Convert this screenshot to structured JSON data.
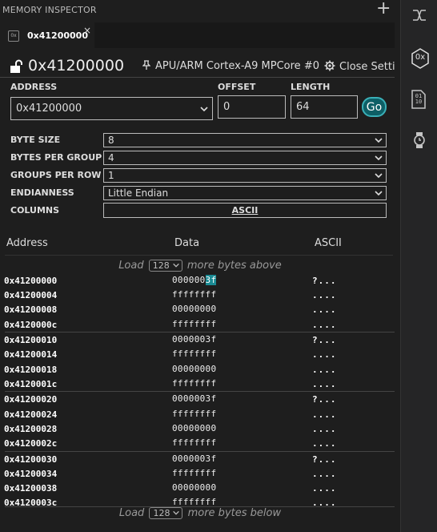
{
  "panel": {
    "title": "MEMORY INSPECTOR",
    "add_icon": "plus-icon"
  },
  "tab": {
    "label": "0x41200000",
    "close": "×"
  },
  "title_row": {
    "address": "0x41200000",
    "core_label": "APU/ARM Cortex-A9 MPCore #0",
    "close_settings_label": "Close Settings"
  },
  "form": {
    "address_label": "ADDRESS",
    "address_value": "0x41200000",
    "offset_label": "OFFSET",
    "offset_value": "0",
    "length_label": "LENGTH",
    "length_value": "64",
    "go_label": "Go"
  },
  "options": {
    "byte_size_label": "BYTE SIZE",
    "byte_size_value": "8",
    "bytes_per_group_label": "BYTES PER GROUP",
    "bytes_per_group_value": "4",
    "groups_per_row_label": "GROUPS PER ROW",
    "groups_per_row_value": "1",
    "endianness_label": "ENDIANNESS",
    "endianness_value": "Little Endian",
    "columns_label": "COLUMNS",
    "columns_button": "ASCII"
  },
  "table": {
    "headers": {
      "address": "Address",
      "data": "Data",
      "ascii": "ASCII"
    },
    "load_above": {
      "prefix": "Load",
      "count": "128",
      "suffix": "more bytes above"
    },
    "load_below": {
      "prefix": "Load",
      "count": "128",
      "suffix": "more bytes below"
    },
    "first_row": {
      "address": "0x41200000",
      "data_plain": "000000",
      "data_highlight": "3f",
      "ascii": "?..."
    },
    "rows": [
      {
        "address": "0x41200004",
        "data": "ffffffff",
        "ascii": "...."
      },
      {
        "address": "0x41200008",
        "data": "00000000",
        "ascii": "...."
      },
      {
        "address": "0x4120000c",
        "data": "ffffffff",
        "ascii": "...."
      },
      {
        "address": "0x41200010",
        "data": "0000003f",
        "ascii": "?..."
      },
      {
        "address": "0x41200014",
        "data": "ffffffff",
        "ascii": "...."
      },
      {
        "address": "0x41200018",
        "data": "00000000",
        "ascii": "...."
      },
      {
        "address": "0x4120001c",
        "data": "ffffffff",
        "ascii": "...."
      },
      {
        "address": "0x41200020",
        "data": "0000003f",
        "ascii": "?..."
      },
      {
        "address": "0x41200024",
        "data": "ffffffff",
        "ascii": "...."
      },
      {
        "address": "0x41200028",
        "data": "00000000",
        "ascii": "...."
      },
      {
        "address": "0x4120002c",
        "data": "ffffffff",
        "ascii": "...."
      },
      {
        "address": "0x41200030",
        "data": "0000003f",
        "ascii": "?..."
      },
      {
        "address": "0x41200034",
        "data": "ffffffff",
        "ascii": "...."
      },
      {
        "address": "0x41200038",
        "data": "00000000",
        "ascii": "...."
      },
      {
        "address": "0x4120003c",
        "data": "ffffffff",
        "ascii": "...."
      }
    ]
  },
  "activity_bar": {
    "icons": [
      "connections-icon",
      "hex-memory-icon",
      "binary-data-icon",
      "watch-icon"
    ],
    "hex_icon_text": "0x",
    "binary_icon_text": "01 10"
  },
  "colors": {
    "background": "#1e1e1e",
    "accent": "#1a8a93",
    "go_button": "#0e5f66"
  }
}
